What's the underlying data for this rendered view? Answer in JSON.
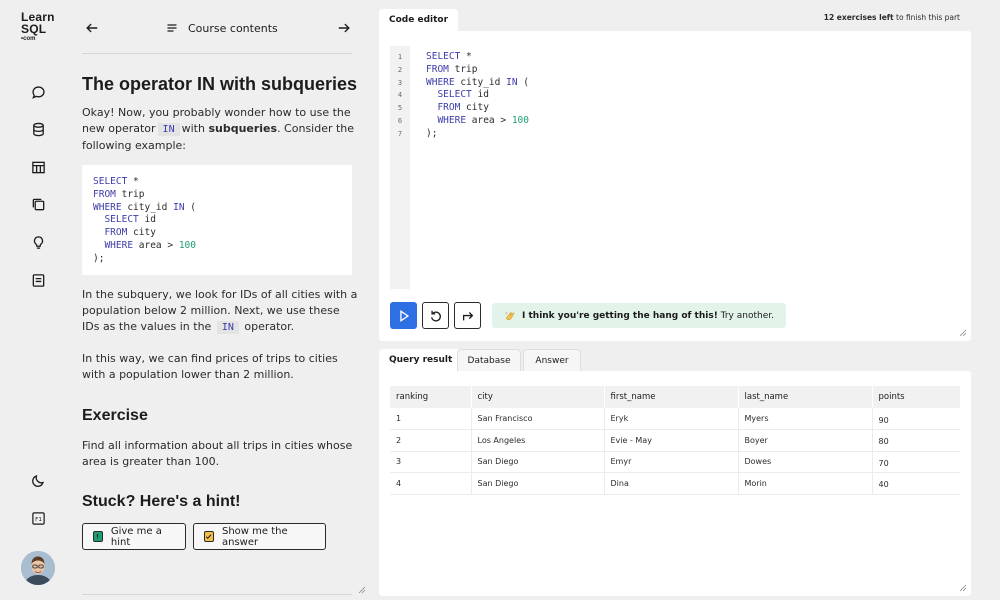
{
  "logo": {
    "line1": "Learn",
    "line2": "SQL",
    "line3": "•com"
  },
  "rail": {
    "icons": [
      "chat-icon",
      "database-icon",
      "table-icon",
      "copy-icon",
      "lightbulb-icon",
      "notes-icon",
      "moon-icon",
      "f1-icon"
    ],
    "f1_label": "F1"
  },
  "lesson": {
    "contents_label": "Course contents",
    "title": "The operator IN with subqueries",
    "intro": {
      "a": "Okay! Now, you probably wonder how to use the new operator",
      "kw": "IN",
      "b": "with",
      "bold": "subqueries",
      "c": ". Consider the following example:"
    },
    "code": [
      {
        "k": "SELECT",
        "t": " *"
      },
      {
        "k": "FROM",
        "t": " trip"
      },
      {
        "k": "WHERE",
        "t": " city_id ",
        "k2": "IN",
        "t2": " ("
      },
      {
        "k": "  SELECT",
        "t": " id"
      },
      {
        "k": "  FROM",
        "t": " city"
      },
      {
        "k": "  WHERE",
        "t": " area > ",
        "n": "100"
      },
      {
        "t": ");"
      }
    ],
    "para2": {
      "a": "In the subquery, we look for IDs of all cities with a population below 2 million. Next, we use these IDs as the values in the",
      "kw": "IN",
      "b": "operator."
    },
    "para3": "In this way, we can find prices of trips to cities with a population lower than 2 million.",
    "exercise_title": "Exercise",
    "exercise_text": "Find all information about all trips in cities whose area is greater than 100.",
    "hint_title": "Stuck? Here's a hint!",
    "hint_button": "Give me a hint",
    "answer_button": "Show me the answer"
  },
  "editor": {
    "tab": "Code editor",
    "exercises_left_bold": "12 exercises left",
    "exercises_left_rest": " to finish this part",
    "line_numbers": [
      "1",
      "2",
      "3",
      "4",
      "5",
      "6",
      "7"
    ],
    "feedback_bold": "I think you're getting the hang of this!",
    "feedback_rest": " Try another."
  },
  "results": {
    "tabs": [
      "Query result",
      "Database",
      "Answer"
    ],
    "columns": [
      "ranking",
      "city",
      "first_name",
      "last_name",
      "points"
    ],
    "rows": [
      [
        "1",
        "San Francisco",
        "Eryk",
        "Myers",
        "90"
      ],
      [
        "2",
        "Los Angeles",
        "Evie - May",
        "Boyer",
        "80"
      ],
      [
        "3",
        "San Diego",
        "Emyr",
        "Dowes",
        "70"
      ],
      [
        "4",
        "San Diego",
        "Dina",
        "Morin",
        "40"
      ]
    ]
  },
  "colors": {
    "run": "#2f6fe4",
    "keyword": "#3d3dab",
    "number": "#1e9d74",
    "hint_icon": "#1e9d74",
    "answer_icon": "#f5c04a"
  }
}
